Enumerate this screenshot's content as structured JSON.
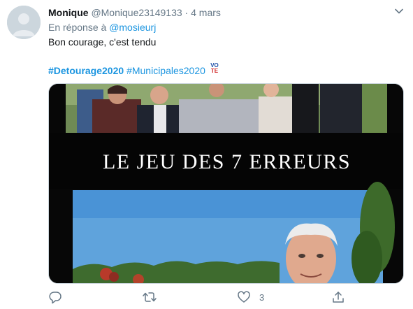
{
  "tweet": {
    "display_name": "Monique",
    "handle": "@Monique23149133",
    "separator": "·",
    "date": "4 mars",
    "reply_prefix": "En réponse à",
    "reply_to": "@mosieurj",
    "text": "Bon courage, c'est tendu",
    "hashtag_1": "#Detourage2020",
    "hashtag_2": "#Municipales2020",
    "vote_emoji_top": "VO",
    "vote_emoji_bottom": "TE",
    "media_title": "LE JEU DES 7 ERREURS",
    "like_count": "3"
  },
  "colors": {
    "accent": "#1b95e0",
    "muted": "#657786",
    "text": "#14171a",
    "border": "#ccd6dd"
  },
  "icons": {
    "avatar": "default-avatar-icon",
    "caret": "chevron-down-icon",
    "reply": "reply-icon",
    "retweet": "retweet-icon",
    "like": "heart-icon",
    "share": "share-icon",
    "vote": "vote-emoji-icon"
  }
}
